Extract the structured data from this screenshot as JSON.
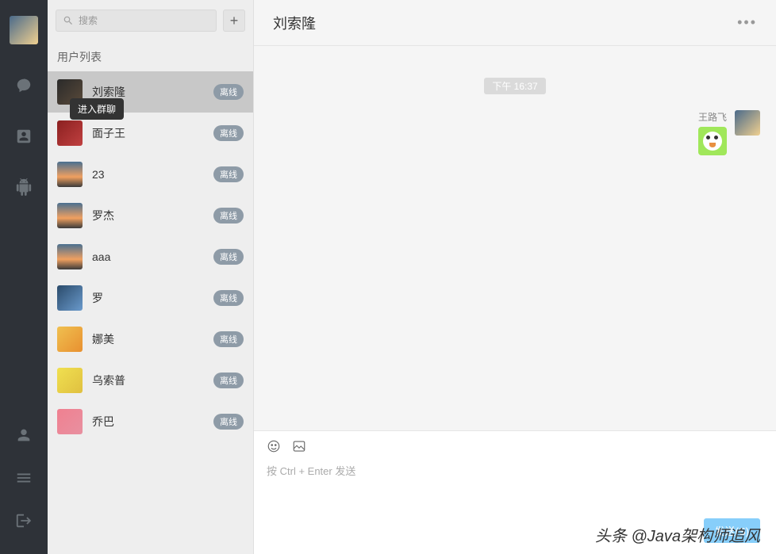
{
  "search": {
    "placeholder": "搜索"
  },
  "tooltip": "进入群聊",
  "list_header": "用户列表",
  "contacts": [
    {
      "name": "刘索隆",
      "status": "离线",
      "avatar": "av-1",
      "active": true
    },
    {
      "name": "面子王",
      "status": "离线",
      "avatar": "av-2",
      "active": false
    },
    {
      "name": "23",
      "status": "离线",
      "avatar": "av-3",
      "active": false
    },
    {
      "name": "罗杰",
      "status": "离线",
      "avatar": "av-3",
      "active": false
    },
    {
      "name": "aaa",
      "status": "离线",
      "avatar": "av-3",
      "active": false
    },
    {
      "name": "罗",
      "status": "离线",
      "avatar": "av-4",
      "active": false
    },
    {
      "name": "娜美",
      "status": "离线",
      "avatar": "av-5",
      "active": false
    },
    {
      "name": "乌索普",
      "status": "离线",
      "avatar": "av-6",
      "active": false
    },
    {
      "name": "乔巴",
      "status": "离线",
      "avatar": "av-7",
      "active": false
    }
  ],
  "chat": {
    "title": "刘索隆",
    "timestamp": "下午 16:37",
    "message_sender": "王路飞"
  },
  "input": {
    "placeholder": "按 Ctrl + Enter 发送",
    "send_label": "发送(S)"
  },
  "watermark": "头条 @Java架构师追风"
}
